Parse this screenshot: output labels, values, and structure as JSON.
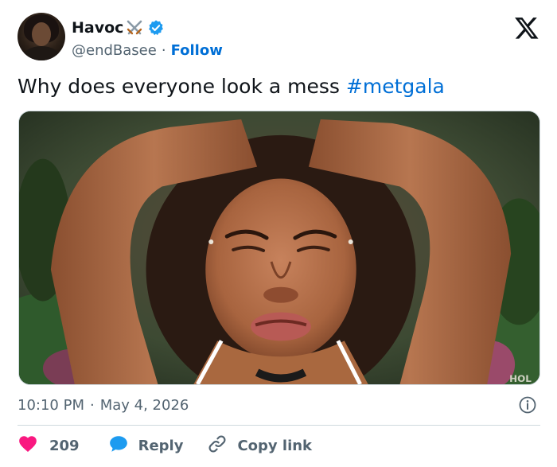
{
  "author": {
    "name": "Havoc",
    "handle": "@endBasee",
    "separator": "·",
    "follow_label": "Follow",
    "name_emoji_icon": "crossed-swords-icon",
    "verified_icon": "verified-badge-icon"
  },
  "brand_icon": "x-logo-icon",
  "tweet": {
    "text": "Why does everyone look a mess ",
    "hashtag": "#metgala"
  },
  "media": {
    "watermark": "HOL"
  },
  "meta": {
    "time": "10:10 PM",
    "separator": "·",
    "date": "May 4, 2026",
    "info_icon": "info-icon"
  },
  "actions": {
    "like_count": "209",
    "reply_label": "Reply",
    "copy_link_label": "Copy link"
  },
  "colors": {
    "link_blue": "#006fd6",
    "heart_red": "#f91880",
    "reply_blue": "#1d9bf0",
    "muted_gray": "#536471",
    "text_dark": "#0f1419"
  }
}
